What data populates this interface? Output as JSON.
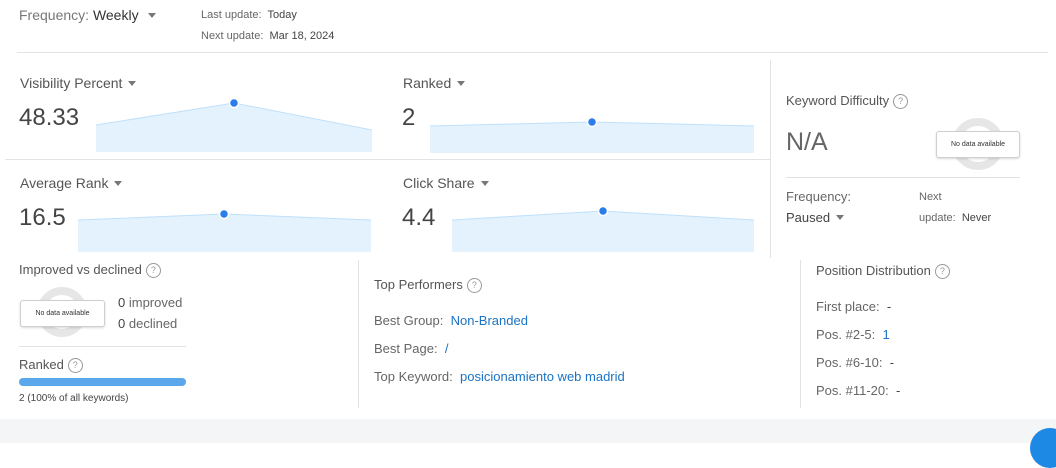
{
  "header": {
    "frequency_label": "Frequency:",
    "frequency_value": "Weekly",
    "last_update_label": "Last update:",
    "last_update_value": "Today",
    "next_update_label": "Next update:",
    "next_update_value": "Mar 18, 2024"
  },
  "metrics": {
    "visibility": {
      "title": "Visibility Percent",
      "value": "48.33"
    },
    "ranked": {
      "title": "Ranked",
      "value": "2"
    },
    "average_rank": {
      "title": "Average Rank",
      "value": "16.5"
    },
    "click_share": {
      "title": "Click Share",
      "value": "4.4"
    }
  },
  "keyword_difficulty": {
    "title": "Keyword Difficulty",
    "value": "N/A",
    "no_data": "No data available",
    "frequency_label": "Frequency:",
    "frequency_value": "Paused",
    "next_label": "Next",
    "update_label": "update:",
    "update_value": "Never"
  },
  "improved": {
    "title": "Improved vs declined",
    "no_data": "No data available",
    "improved_count": "0",
    "improved_label": "improved",
    "declined_count": "0",
    "declined_label": "declined",
    "ranked_title": "Ranked",
    "ranked_caption": "2 (100% of all keywords)",
    "ranked_fraction": 1.0
  },
  "top_performers": {
    "title": "Top Performers",
    "best_group_label": "Best Group:",
    "best_group_value": "Non-Branded",
    "best_page_label": "Best Page:",
    "best_page_value": "/",
    "top_keyword_label": "Top Keyword:",
    "top_keyword_value": "posicionamiento web madrid"
  },
  "position_distribution": {
    "title": "Position Distribution",
    "rows": [
      {
        "label": "First place:",
        "value": "-"
      },
      {
        "label": "Pos. #2-5:",
        "value": "1"
      },
      {
        "label": "Pos. #6-10:",
        "value": "-"
      },
      {
        "label": "Pos. #11-20:",
        "value": "-"
      }
    ]
  },
  "colors": {
    "accent": "#2b7de9",
    "sparkline_fill": "#e3f2fd",
    "link": "#1a73c4"
  }
}
